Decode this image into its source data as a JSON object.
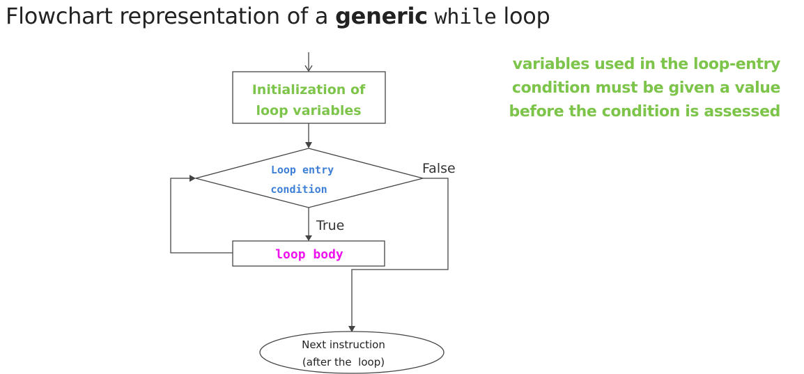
{
  "title": {
    "prefix": "Flowchart representation of a ",
    "bold_word": "generic",
    "code_word": "while",
    "suffix": "loop"
  },
  "note": {
    "lines": [
      "variables used in the loop-entry",
      "condition must be given a value",
      "before the condition is assessed"
    ],
    "color": "#7dc44a"
  },
  "flowchart": {
    "init_box": {
      "lines": [
        "Initialization of",
        "loop variables"
      ]
    },
    "condition": {
      "lines": [
        "Loop entry",
        "condition"
      ]
    },
    "body_box": {
      "label": "loop body"
    },
    "edge_labels": {
      "false": "False",
      "true": "True"
    },
    "terminal": {
      "lines": [
        "Next instruction",
        "(after the  loop)"
      ]
    }
  },
  "colors": {
    "green": "#7dc44a",
    "blue": "#3d7fd6",
    "magenta": "#ee11ee",
    "line": "#444444"
  }
}
